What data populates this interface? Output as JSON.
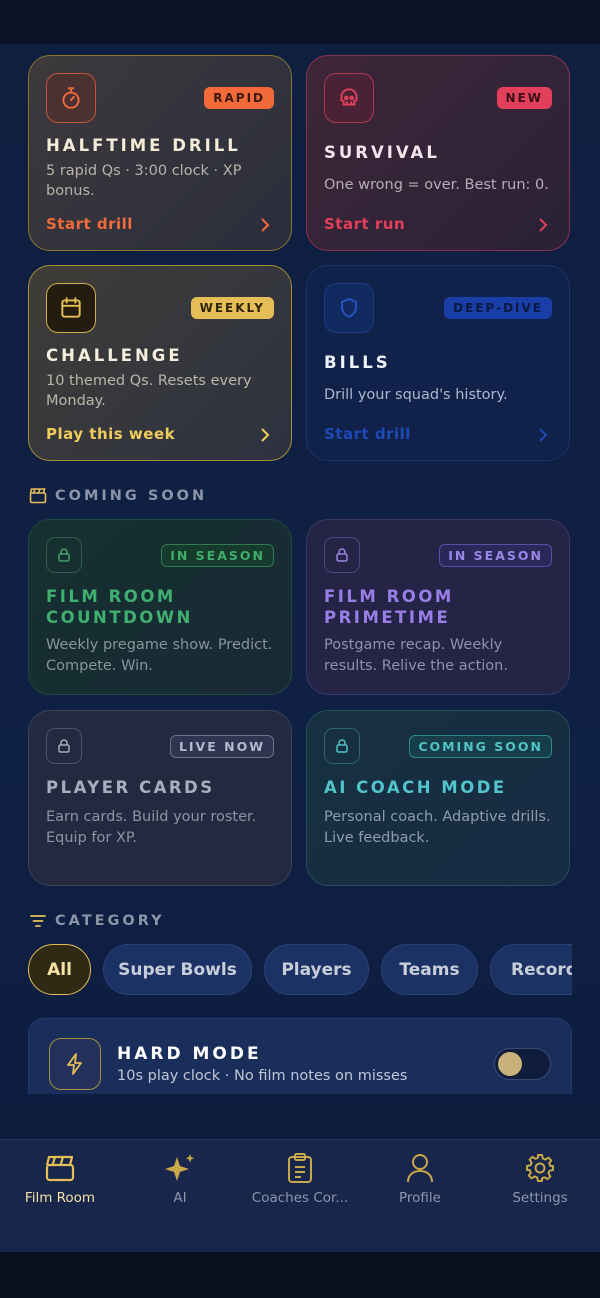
{
  "modes": {
    "halftime": {
      "badge": "RAPID",
      "title": "HALFTIME DRILL",
      "desc": "5 rapid Qs · 3:00 clock · XP bonus.",
      "cta": "Start drill",
      "icon": "stopwatch-icon"
    },
    "survival": {
      "badge": "NEW",
      "title": "SURVIVAL",
      "desc": "One wrong = over. Best run: 0.",
      "cta": "Start run",
      "icon": "skull-icon"
    },
    "challenge": {
      "badge": "WEEKLY",
      "title": "CHALLENGE",
      "desc": "10 themed Qs. Resets every Monday.",
      "cta": "Play this week",
      "icon": "calendar-icon"
    },
    "bills": {
      "badge": "DEEP-DIVE",
      "title": "BILLS",
      "desc": "Drill your squad's history.",
      "cta": "Start drill",
      "icon": "shield-icon"
    }
  },
  "coming_soon": {
    "label": "COMING SOON",
    "items": [
      {
        "badge": "IN SEASON",
        "title": "FILM ROOM COUNTDOWN",
        "desc": "Weekly pregame show. Predict. Compete. Win."
      },
      {
        "badge": "IN SEASON",
        "title": "FILM ROOM PRIMETIME",
        "desc": "Postgame recap. Weekly results. Relive the action."
      },
      {
        "badge": "LIVE NOW",
        "title": "PLAYER CARDS",
        "desc": "Earn cards. Build your roster. Equip for XP."
      },
      {
        "badge": "COMING SOON",
        "title": "AI COACH MODE",
        "desc": "Personal coach. Adaptive drills. Live feedback."
      }
    ]
  },
  "category": {
    "label": "CATEGORY",
    "chips": [
      "All",
      "Super Bowls",
      "Players",
      "Teams",
      "Records"
    ],
    "selected": "All"
  },
  "hard_mode": {
    "title": "HARD MODE",
    "desc": "10s play clock · No film notes on misses",
    "enabled": false
  },
  "nav": [
    {
      "label": "Film Room",
      "icon": "clapperboard-icon",
      "active": true
    },
    {
      "label": "AI",
      "icon": "sparkle-icon",
      "active": false
    },
    {
      "label": "Coaches Cor...",
      "icon": "clipboard-icon",
      "active": false
    },
    {
      "label": "Profile",
      "icon": "person-icon",
      "active": false
    },
    {
      "label": "Settings",
      "icon": "gear-icon",
      "active": false
    }
  ],
  "colors": {
    "gold": "#e6be57",
    "orange": "#f26a3a",
    "red": "#e2405a",
    "blue": "#2a55c8"
  }
}
